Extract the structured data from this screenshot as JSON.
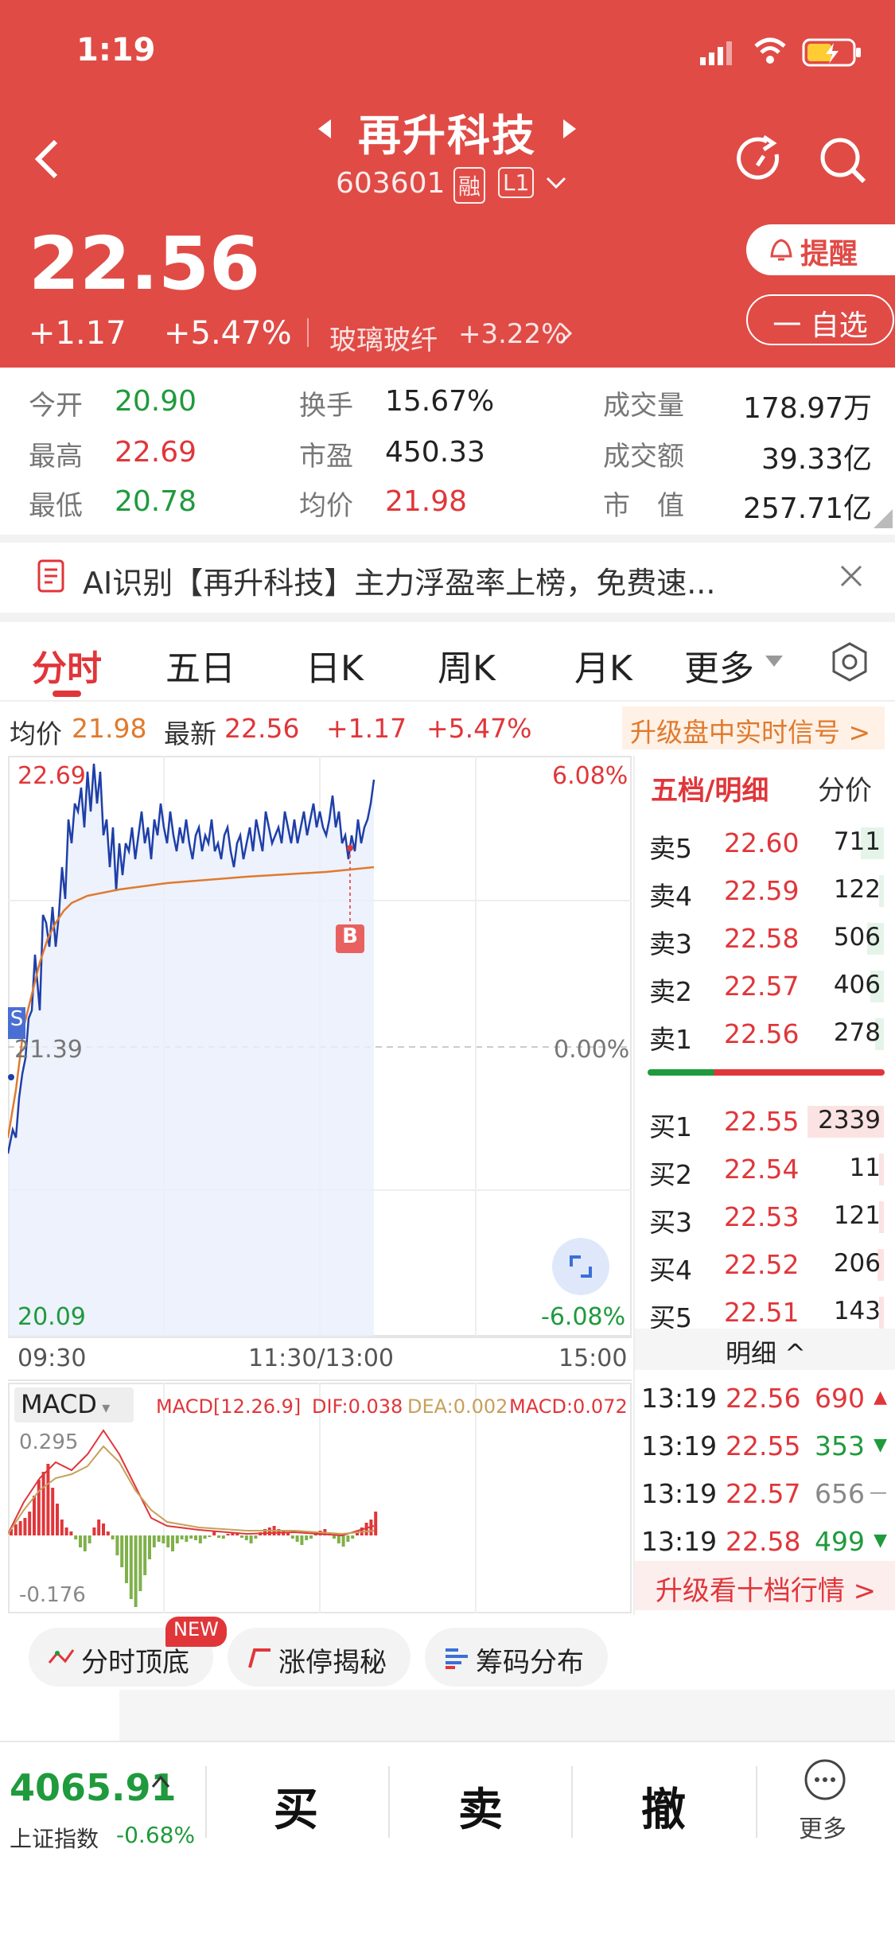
{
  "status": {
    "time": "1:19"
  },
  "stock": {
    "name": "再升科技",
    "code": "603601",
    "tag1": "融",
    "tag2": "L1",
    "price": "22.56",
    "change": "+1.17",
    "pct": "+5.47%",
    "sector": "玻璃玻纤",
    "sector_pct": "+3.22%",
    "remind": "提醒",
    "watch": "一 自选"
  },
  "stats": {
    "open_l": "今开",
    "open": "20.90",
    "turnover_l": "换手",
    "turnover": "15.67%",
    "vol_l": "成交量",
    "vol": "178.97万",
    "high_l": "最高",
    "high": "22.69",
    "pe_l": "市盈",
    "pe": "450.33",
    "amount_l": "成交额",
    "amount": "39.33亿",
    "low_l": "最低",
    "low": "20.78",
    "avg_l": "均价",
    "avg": "21.98",
    "cap_l": "市　值",
    "cap": "257.71亿"
  },
  "banner": {
    "text": "AI识别【再升科技】主力浮盈率上榜，免费速..."
  },
  "tabs": [
    "分时",
    "五日",
    "日K",
    "周K",
    "月K",
    "更多"
  ],
  "info_line": {
    "avg_l": "均价",
    "avg": "21.98",
    "latest_l": "最新",
    "latest": "22.56",
    "chg": "+1.17",
    "pct": "+5.47%",
    "upgrade": "升级盘中实时信号 >"
  },
  "chart": {
    "top": "22.69",
    "top_pct": "6.08%",
    "mid": "21.39",
    "mid_pct": "0.00%",
    "bot": "20.09",
    "bot_pct": "-6.08%",
    "t0": "09:30",
    "t1": "11:30/13:00",
    "t2": "15:00",
    "s_badge": "S",
    "b_badge": "B"
  },
  "macd": {
    "label": "MACD",
    "params": "MACD[12.26.9]",
    "dif": "DIF:0.038",
    "dea": "DEA:0.002",
    "macd": "MACD:0.072",
    "top": "0.295",
    "bot": "-0.176"
  },
  "orderbook": {
    "title": "五档/明细",
    "side": "分价",
    "sells": [
      {
        "l": "卖5",
        "p": "22.60",
        "v": "711"
      },
      {
        "l": "卖4",
        "p": "22.59",
        "v": "122"
      },
      {
        "l": "卖3",
        "p": "22.58",
        "v": "506"
      },
      {
        "l": "卖2",
        "p": "22.57",
        "v": "406"
      },
      {
        "l": "卖1",
        "p": "22.56",
        "v": "278"
      }
    ],
    "buys": [
      {
        "l": "买1",
        "p": "22.55",
        "v": "2339"
      },
      {
        "l": "买2",
        "p": "22.54",
        "v": "11"
      },
      {
        "l": "买3",
        "p": "22.53",
        "v": "121"
      },
      {
        "l": "买4",
        "p": "22.52",
        "v": "206"
      },
      {
        "l": "买5",
        "p": "22.51",
        "v": "143"
      }
    ],
    "detail": "明细 ^",
    "ticks": [
      {
        "t": "13:19",
        "p": "22.56",
        "v": "690"
      },
      {
        "t": "13:19",
        "p": "22.55",
        "v": "353"
      },
      {
        "t": "13:19",
        "p": "22.57",
        "v": "656"
      },
      {
        "t": "13:19",
        "p": "22.58",
        "v": "499"
      }
    ],
    "upgrade": "升级看十档行情 >"
  },
  "tools": {
    "t1": "分时顶底",
    "new": "NEW",
    "t2": "涨停揭秘",
    "t3": "筹码分布"
  },
  "footer": {
    "index_val": "4065.91",
    "index_name": "上证指数",
    "index_pct": "-0.68%",
    "buy": "买",
    "sell": "卖",
    "cancel": "撤",
    "more": "更多"
  },
  "colors": {
    "header": "#e04b46",
    "up": "#e0363a",
    "down": "#1f9a3c",
    "avg_line": "#e07a2e",
    "price_line": "#1f3fa8"
  }
}
